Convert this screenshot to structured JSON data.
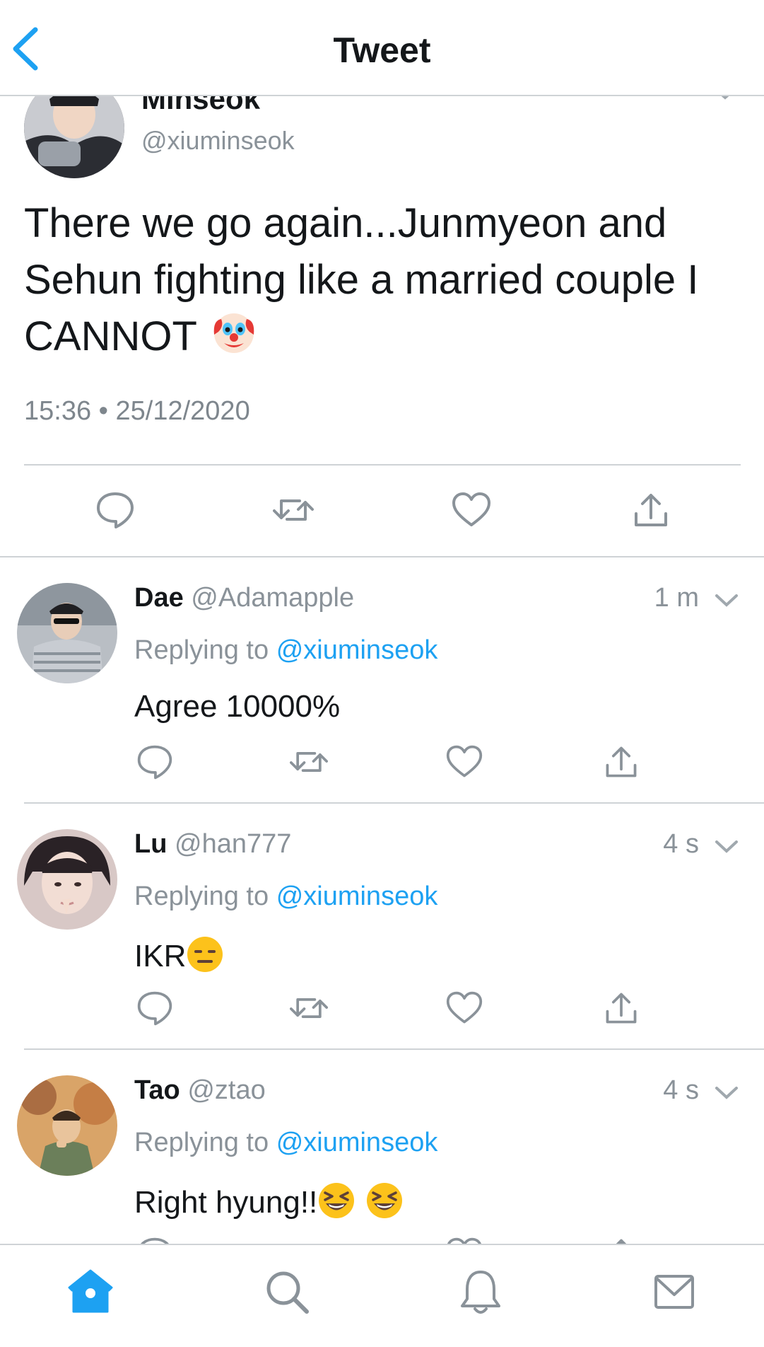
{
  "header": {
    "title": "Tweet",
    "back_icon": "chevron-left-icon"
  },
  "main_tweet": {
    "display_name": "Minseok",
    "handle": "@xiuminseok",
    "text": "There we go again...Junmyeon and Sehun fighting like a married couple I CANNOT",
    "emoji": "clown-face",
    "timestamp": "15:36 • 25/12/2020",
    "actions": [
      "reply-icon",
      "retweet-icon",
      "like-icon",
      "share-icon"
    ]
  },
  "replies": [
    {
      "name": "Dae",
      "handle": "@Adamapple",
      "time": "1 m",
      "replying_label": "Replying to",
      "replying_to": "@xiuminseok",
      "text": "Agree 10000%",
      "emoji": []
    },
    {
      "name": "Lu",
      "handle": "@han777",
      "time": "4 s",
      "replying_label": "Replying to",
      "replying_to": "@xiuminseok",
      "text": "IKR",
      "emoji": [
        "expressionless-face"
      ]
    },
    {
      "name": "Tao",
      "handle": "@ztao",
      "time": "4 s",
      "replying_label": "Replying to",
      "replying_to": "@xiuminseok",
      "text": "Right hyung!!",
      "emoji": [
        "grinning-squinting-face",
        "grinning-squinting-face"
      ]
    }
  ],
  "tab_bar": [
    "home-icon",
    "search-icon",
    "notifications-icon",
    "messages-icon"
  ],
  "colors": {
    "accent": "#1da1f2",
    "text": "#14171a",
    "secondary": "#8a9299",
    "divider": "#cfd3d6"
  }
}
